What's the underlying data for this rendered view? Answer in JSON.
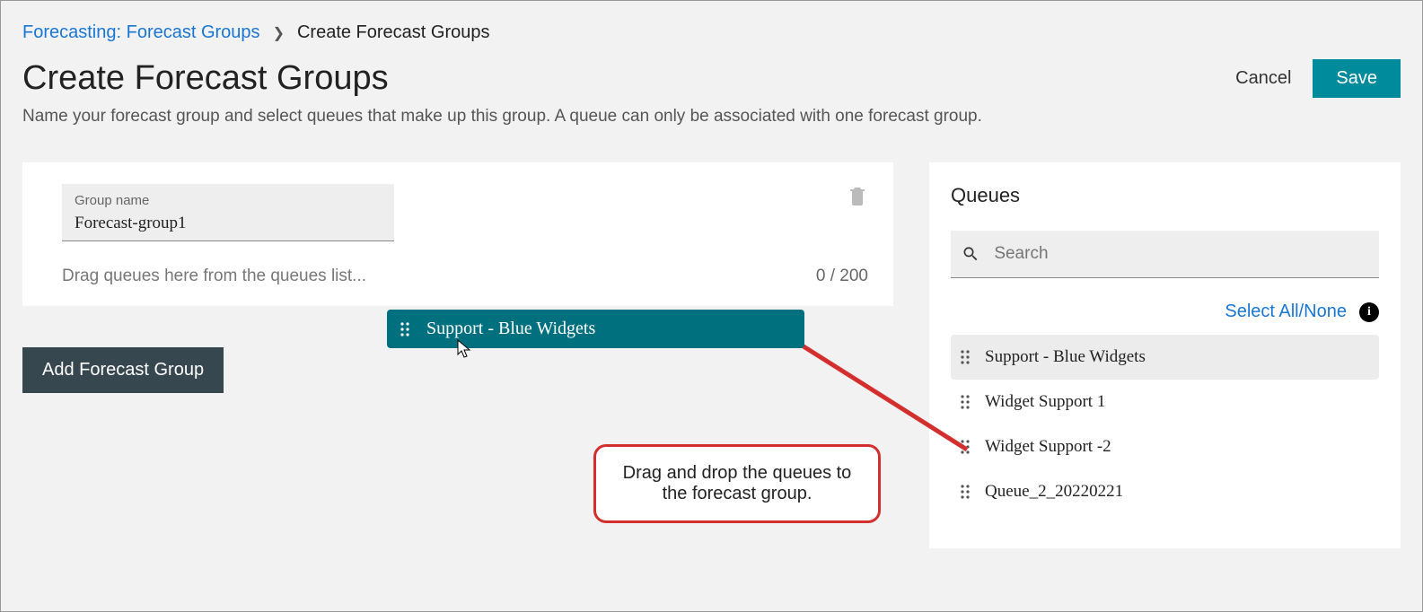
{
  "breadcrumb": {
    "parent": "Forecasting: Forecast Groups",
    "current": "Create Forecast Groups"
  },
  "page": {
    "title": "Create Forecast Groups",
    "subtitle": "Name your forecast group and select queues that make up this group. A queue can only be associated with one forecast group."
  },
  "actions": {
    "cancel": "Cancel",
    "save": "Save",
    "add_group": "Add Forecast Group"
  },
  "group_card": {
    "name_label": "Group name",
    "name_value": "Forecast-group1",
    "drop_hint": "Drag queues here from the queues list...",
    "count_text": "0 / 200"
  },
  "dragging_queue": {
    "label": "Support - Blue Widgets"
  },
  "queues_panel": {
    "title": "Queues",
    "search_placeholder": "Search",
    "select_all_label": "Select All/None",
    "items": [
      "Support - Blue Widgets",
      "Widget Support 1",
      "Widget Support -2",
      "Queue_2_20220221"
    ]
  },
  "callout": {
    "text": "Drag and drop the queues to the forecast group."
  }
}
